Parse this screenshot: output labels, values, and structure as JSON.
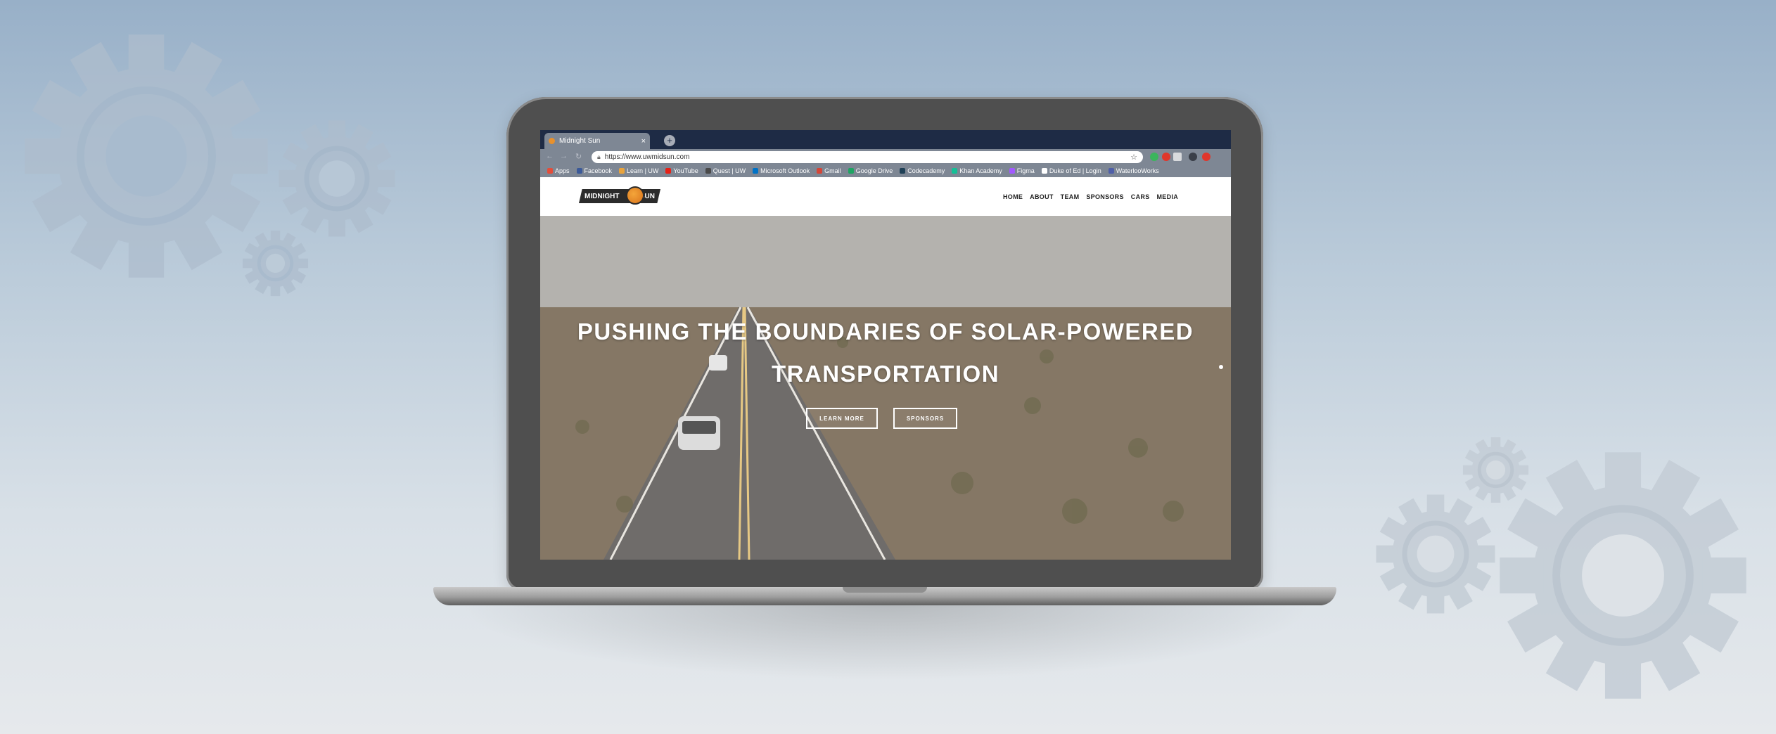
{
  "browser": {
    "tab_title": "Midnight Sun",
    "tab_close": "×",
    "new_tab": "+",
    "back": "←",
    "forward": "→",
    "reload": "↻",
    "url": "https://www.uwmidsun.com",
    "bookmarks": [
      {
        "label": "Apps",
        "color": "#e44d3a"
      },
      {
        "label": "Facebook",
        "color": "#3b5998"
      },
      {
        "label": "Learn | UW",
        "color": "#e8a33d"
      },
      {
        "label": "YouTube",
        "color": "#e62117"
      },
      {
        "label": "Quest | UW",
        "color": "#4a4a4a"
      },
      {
        "label": "Microsoft Outlook",
        "color": "#0072c6"
      },
      {
        "label": "Gmail",
        "color": "#d44638"
      },
      {
        "label": "Google Drive",
        "color": "#1fa463"
      },
      {
        "label": "Codecademy",
        "color": "#1f4056"
      },
      {
        "label": "Khan Academy",
        "color": "#14bf96"
      },
      {
        "label": "Figma",
        "color": "#a259ff"
      },
      {
        "label": "Duke of Ed | Login",
        "color": "#ffffff"
      },
      {
        "label": "WaterlooWorks",
        "color": "#4f5fa8"
      }
    ]
  },
  "site": {
    "logo_left": "MIDNIGHT",
    "logo_right": "SUN",
    "menu": [
      "HOME",
      "ABOUT",
      "TEAM",
      "SPONSORS",
      "CARS",
      "MEDIA"
    ],
    "hero_line1": "PUSHING THE BOUNDARIES OF SOLAR-POWERED",
    "hero_line2": "TRANSPORTATION",
    "btn_learn": "LEARN MORE",
    "btn_sponsors": "SPONSORS"
  },
  "colors": {
    "tabbar": "#1e2b45",
    "chrome": "#7e8794",
    "logo_orange": "#e8912d"
  }
}
